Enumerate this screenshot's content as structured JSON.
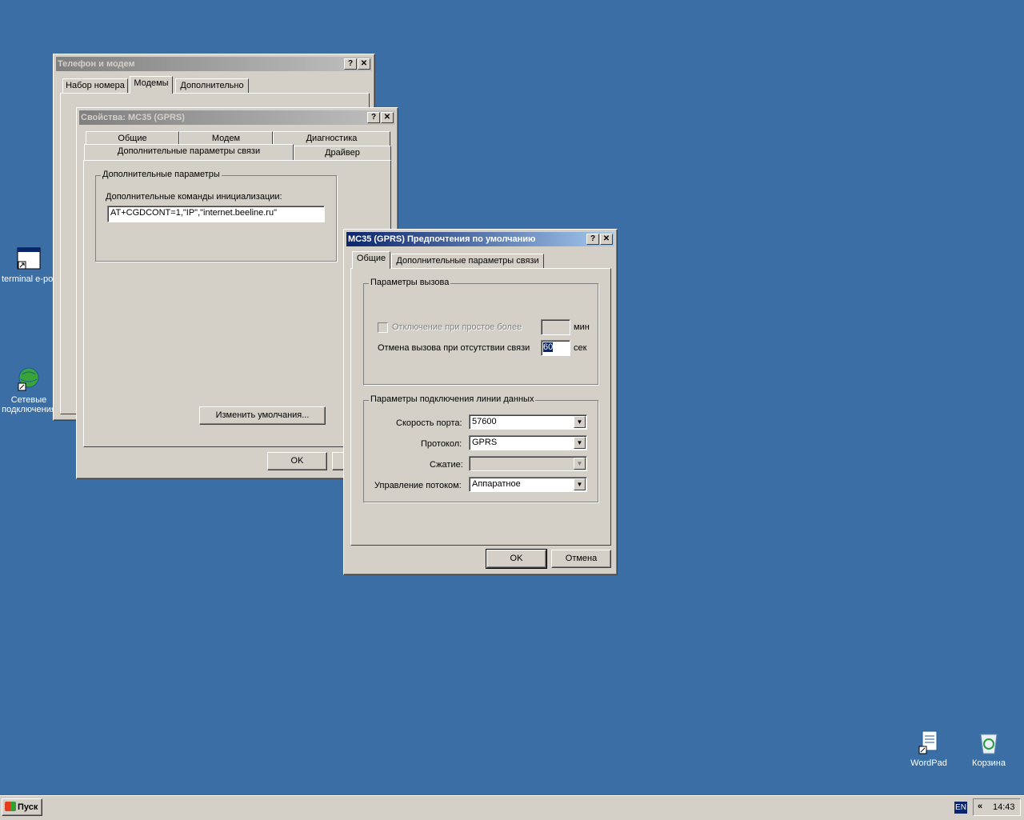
{
  "desktop": {
    "icons": [
      {
        "label": "terminal e-port"
      },
      {
        "label_line1": "Сетевые",
        "label_line2": "подключения"
      },
      {
        "label": "WordPad"
      },
      {
        "label": "Корзина"
      }
    ]
  },
  "win_phone": {
    "title": "Телефон и модем",
    "tabs": [
      "Набор номера",
      "Модемы",
      "Дополнительно"
    ]
  },
  "win_props": {
    "title": "Свойства: MC35 (GPRS)",
    "tabs_row1": [
      "Общие",
      "Модем",
      "Диагностика"
    ],
    "tabs_row2": [
      "Дополнительные параметры связи",
      "Драйвер"
    ],
    "group_title": "Дополнительные параметры",
    "init_label": "Дополнительные команды инициализации:",
    "init_value": "AT+CGDCONT=1,\"IP\",\"internet.beeline.ru\"",
    "change_defaults": "Изменить умолчания...",
    "ok": "OK"
  },
  "win_prefs": {
    "title": "MC35 (GPRS) Предпочтения по умолчанию",
    "tabs": [
      "Общие",
      "Дополнительные параметры связи"
    ],
    "call_group": "Параметры вызова",
    "idle_label": "Отключение при простое более",
    "idle_unit": "мин",
    "cancel_label": "Отмена вызова при отсутствии связи",
    "cancel_value": "60",
    "cancel_unit": "сек",
    "data_group": "Параметры подключения линии данных",
    "port_speed_label": "Скорость порта:",
    "port_speed_value": "57600",
    "protocol_label": "Протокол:",
    "protocol_value": "GPRS",
    "compression_label": "Сжатие:",
    "compression_value": "",
    "flow_label": "Управление потоком:",
    "flow_value": "Аппаратное",
    "ok": "OK",
    "cancel": "Отмена"
  },
  "taskbar": {
    "start": "Пуск",
    "lang": "EN",
    "chevron": "«",
    "clock": "14:43"
  }
}
